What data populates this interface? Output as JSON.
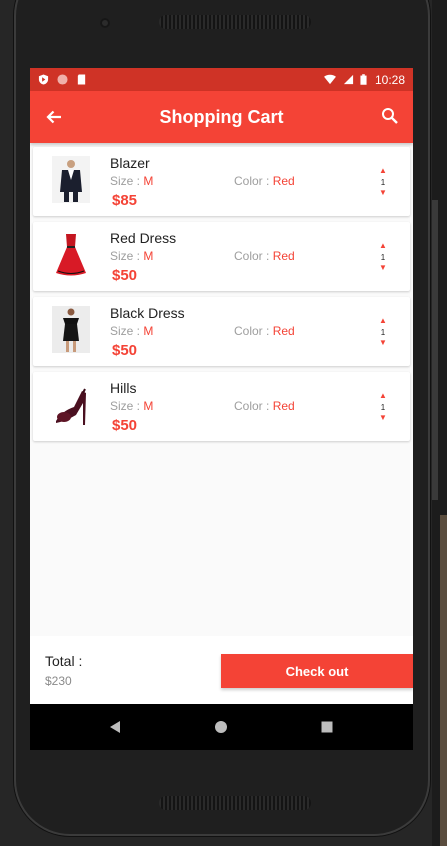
{
  "status_bar": {
    "time": "10:28",
    "left_icons": [
      "shield-icon",
      "circle-icon",
      "sd-card-icon"
    ],
    "right_icons": [
      "wifi-icon",
      "signal-icon",
      "battery-icon"
    ]
  },
  "app_bar": {
    "title": "Shopping Cart",
    "back_icon": "arrow-left-icon",
    "search_icon": "search-icon"
  },
  "colors": {
    "primary": "#f44336",
    "status_bar": "#cf3326",
    "accent_text": "#f44336"
  },
  "cart": {
    "size_prefix": "Size : ",
    "color_prefix": "Color : ",
    "items": [
      {
        "name": "Blazer",
        "size": "M",
        "color": "Red",
        "price": "$85",
        "qty": "1",
        "image": "blazer"
      },
      {
        "name": "Red Dress",
        "size": "M",
        "color": "Red",
        "price": "$50",
        "qty": "1",
        "image": "red-dress"
      },
      {
        "name": "Black Dress",
        "size": "M",
        "color": "Red",
        "price": "$50",
        "qty": "1",
        "image": "black-dress"
      },
      {
        "name": "Hills",
        "size": "M",
        "color": "Red",
        "price": "$50",
        "qty": "1",
        "image": "heels"
      }
    ]
  },
  "footer": {
    "total_label": "Total :",
    "total_value": "$230",
    "checkout_label": "Check out"
  },
  "nav_bar": {
    "buttons": [
      "back-triangle-icon",
      "home-circle-icon",
      "recents-square-icon"
    ]
  }
}
